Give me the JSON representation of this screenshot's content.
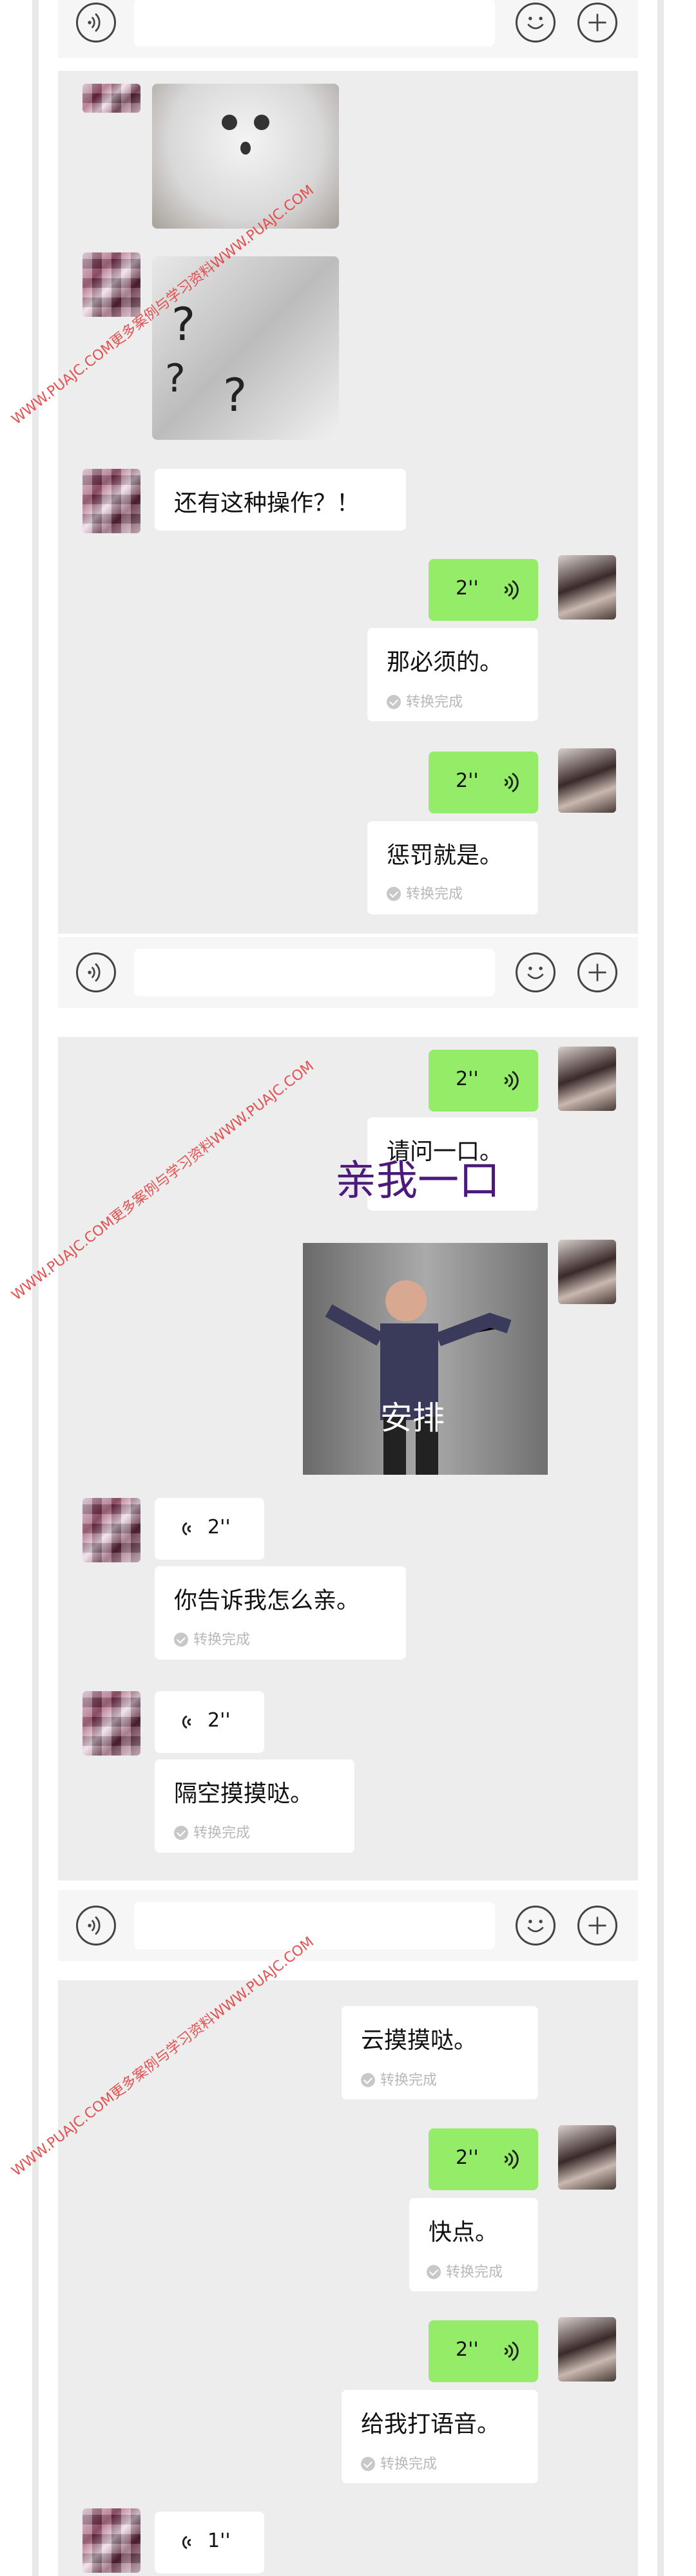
{
  "watermark": "WWW.PUAJC.COM更多案例与学习资料WWW.PUAJC.COM",
  "icons": {
    "voice": "voice-icon",
    "emoji": "emoji-icon",
    "plus": "plus-icon"
  },
  "chat1": {
    "msg_left_1": "还有这种操作？！",
    "voice_right_1": "2''",
    "text_right_1": "那必须的。",
    "voice_right_2": "2''",
    "text_right_2": "惩罚就是。",
    "conv_done": "转换完成"
  },
  "chat2": {
    "voice_right_1": "2''",
    "text_right_1": "请问一口。",
    "overlay": "亲我一口",
    "image_caption": "安排",
    "voice_left_1": "2''",
    "text_left_1": "你告诉我怎么亲。",
    "voice_left_2": "2''",
    "text_left_2": "隔空摸摸哒。",
    "conv_done": "转换完成"
  },
  "chat3": {
    "text_right_0": "云摸摸哒。",
    "voice_right_1": "2''",
    "text_right_1": "快点。",
    "voice_right_2": "2''",
    "text_right_2": "给我打语音。",
    "voice_left_1": "1''",
    "conv_done": "转换完成"
  }
}
